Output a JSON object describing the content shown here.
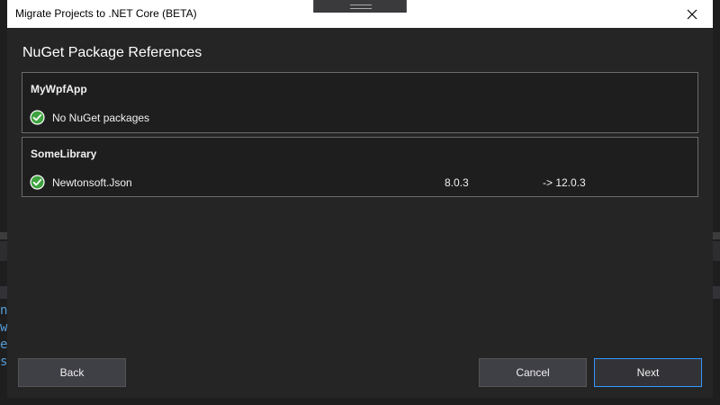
{
  "window": {
    "title": "Migrate Projects to .NET Core (BETA)"
  },
  "heading": "NuGet Package References",
  "projects": [
    {
      "name": "MyWpfApp",
      "package": {
        "name": "No NuGet packages",
        "status_icon": "check-circle-icon"
      }
    },
    {
      "name": "SomeLibrary",
      "package": {
        "name": "Newtonsoft.Json",
        "current_version": "8.0.3",
        "new_version": "-> 12.0.3",
        "status_icon": "check-circle-icon"
      }
    }
  ],
  "buttons": {
    "back": "Back",
    "cancel": "Cancel",
    "next": "Next"
  },
  "background": {
    "code_letters": "n\nw\ne\ns"
  },
  "colors": {
    "dialog_bg": "#252526",
    "panel_bg": "#1e1e1e",
    "check_green": "#3fa33f",
    "focus_border": "#3399ff"
  }
}
